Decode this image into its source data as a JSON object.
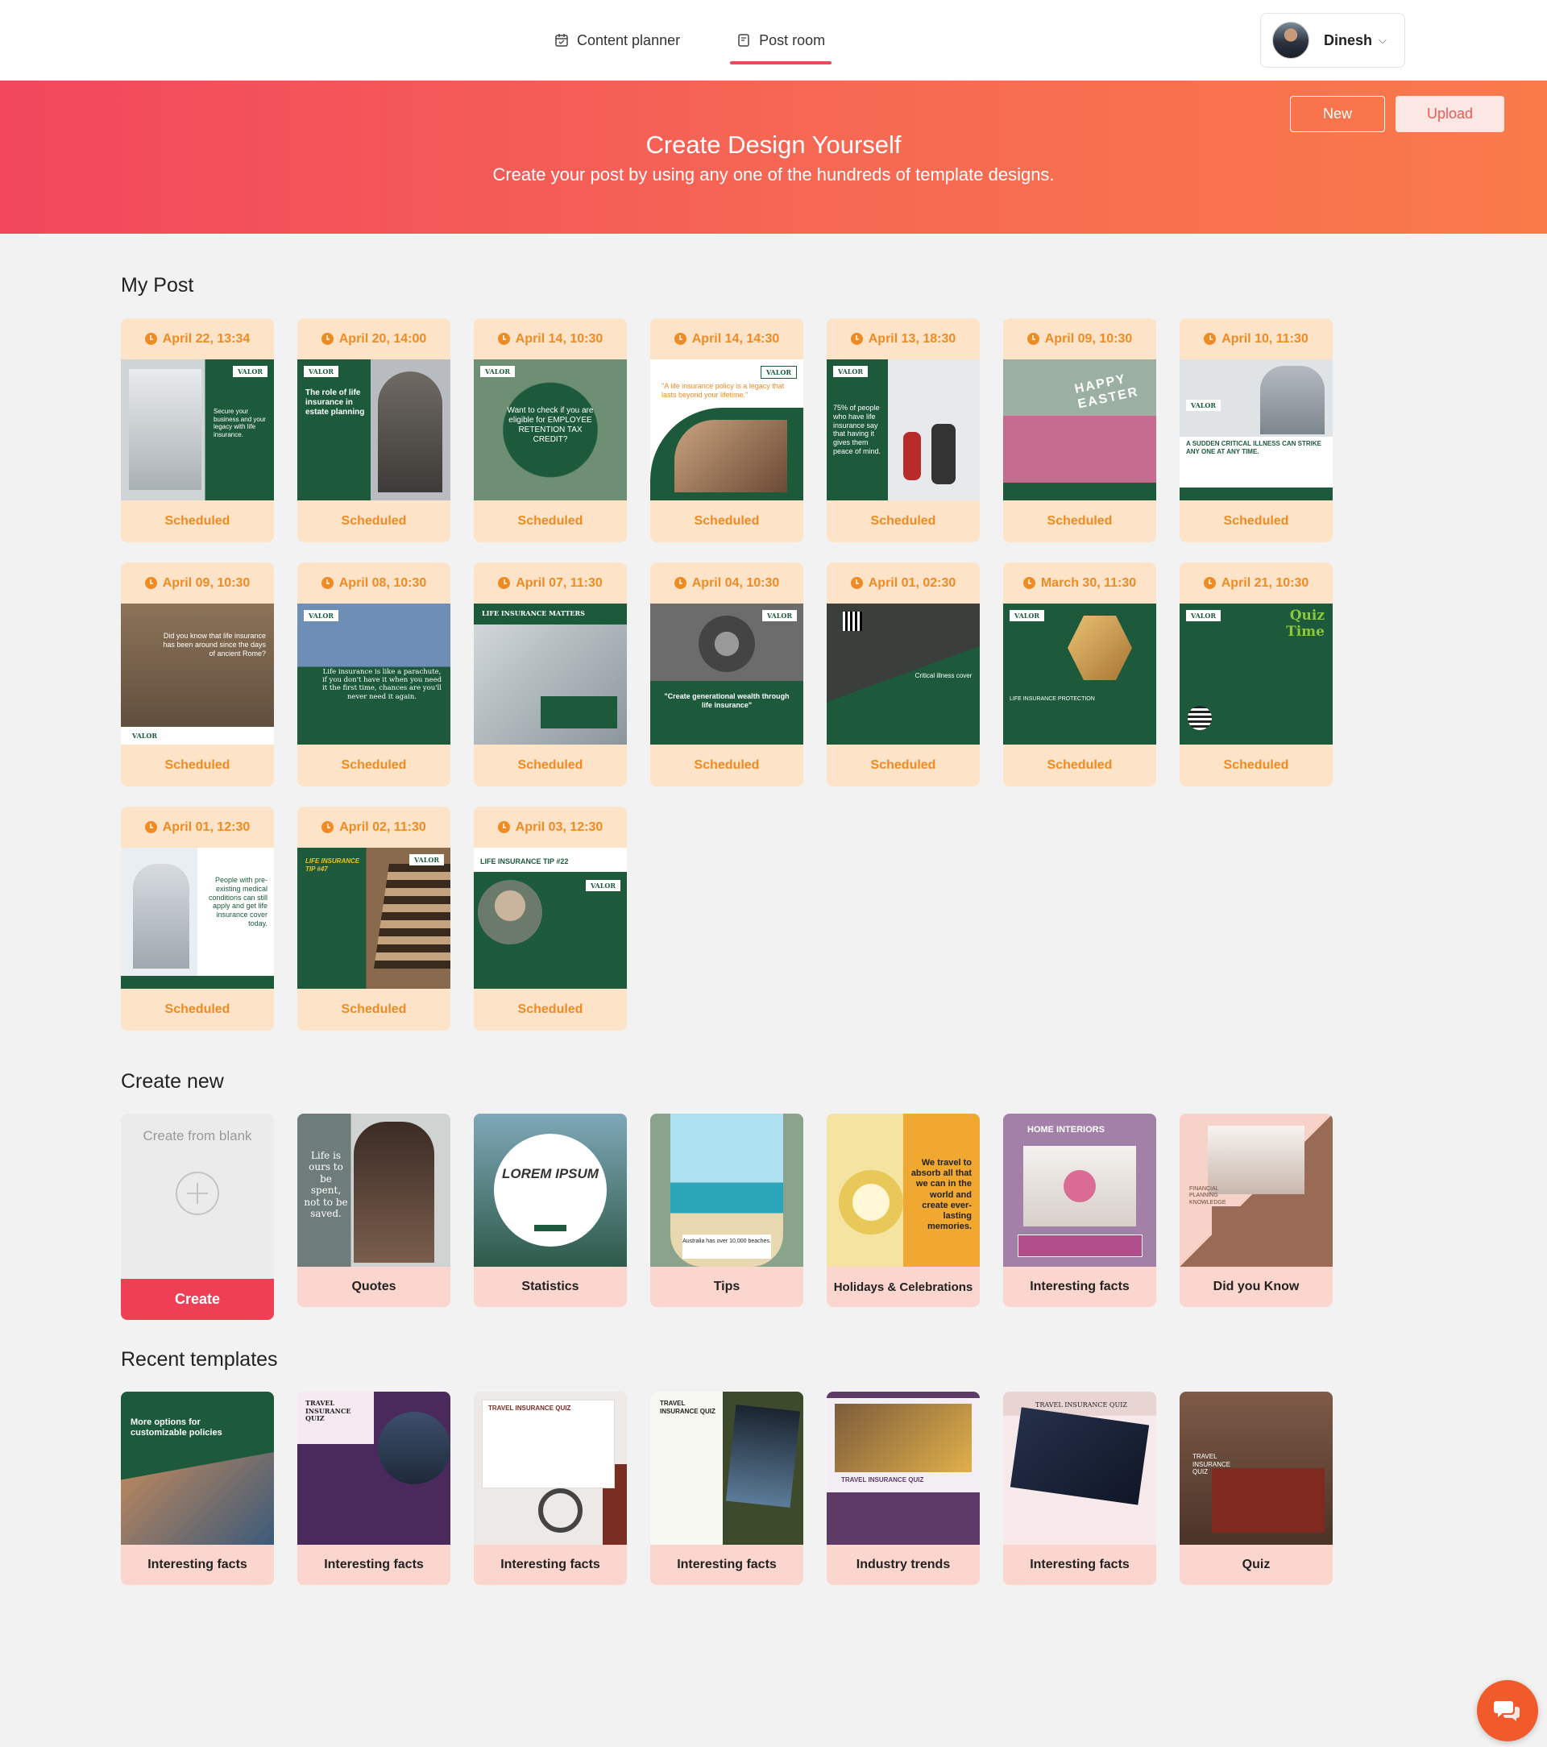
{
  "nav": {
    "content_planner": "Content planner",
    "post_room": "Post room"
  },
  "user": {
    "name": "Dinesh"
  },
  "banner": {
    "title": "Create Design Yourself",
    "subtitle": "Create your post by using any one of the hundreds of template designs.",
    "new_label": "New",
    "upload_label": "Upload"
  },
  "my_post": {
    "title": "My Post",
    "posts": [
      {
        "date": "April 22, 13:34",
        "status": "Scheduled",
        "headline": "Secure your business and your legacy with life insurance."
      },
      {
        "date": "April 20, 14:00",
        "status": "Scheduled",
        "headline": "The role of life insurance in estate planning"
      },
      {
        "date": "April 14, 10:30",
        "status": "Scheduled",
        "headline": "Want to check if you are eligible for EMPLOYEE RETENTION TAX CREDIT?"
      },
      {
        "date": "April 14, 14:30",
        "status": "Scheduled",
        "headline": "\"A life insurance policy is a legacy that lasts beyond your lifetime.\""
      },
      {
        "date": "April 13, 18:30",
        "status": "Scheduled",
        "headline": "75% of people who have life insurance say that having it gives them peace of mind."
      },
      {
        "date": "April 09, 10:30",
        "status": "Scheduled",
        "headline": "HAPPY EASTER"
      },
      {
        "date": "April 10, 11:30",
        "status": "Scheduled",
        "headline": "A SUDDEN CRITICAL ILLNESS CAN STRIKE ANY ONE AT ANY TIME."
      },
      {
        "date": "April 09, 10:30",
        "status": "Scheduled",
        "headline": "Did you know that life insurance has been around since the days of ancient Rome?"
      },
      {
        "date": "April 08, 10:30",
        "status": "Scheduled",
        "headline": "Life insurance is like a parachute, if you don't have it when you need it the first time, chances are you'll never need it again."
      },
      {
        "date": "April 07, 11:30",
        "status": "Scheduled",
        "headline": "LIFE INSURANCE MATTERS"
      },
      {
        "date": "April 04, 10:30",
        "status": "Scheduled",
        "headline": "\"Create generational wealth through life insurance\""
      },
      {
        "date": "April 01, 02:30",
        "status": "Scheduled",
        "headline": "Critical illness cover"
      },
      {
        "date": "March 30, 11:30",
        "status": "Scheduled",
        "headline": "LIFE INSURANCE PROTECTION"
      },
      {
        "date": "April 21, 10:30",
        "status": "Scheduled",
        "headline": "Quiz Time"
      },
      {
        "date": "April 01, 12:30",
        "status": "Scheduled",
        "headline": "People with pre-existing medical conditions can still apply and get life insurance cover today."
      },
      {
        "date": "April 02, 11:30",
        "status": "Scheduled",
        "headline": "LIFE INSURANCE TIP #47"
      },
      {
        "date": "April 03, 12:30",
        "status": "Scheduled",
        "headline": "LIFE INSURANCE TIP #22"
      }
    ]
  },
  "create_new": {
    "title": "Create new",
    "blank_label": "Create from blank",
    "create_label": "Create",
    "templates": [
      {
        "label": "Quotes",
        "thumb_text": "Life is ours to be spent, not to be saved."
      },
      {
        "label": "Statistics",
        "thumb_text": "LOREM IPSUM"
      },
      {
        "label": "Tips",
        "thumb_text": "Australia has over 10,000 beaches."
      },
      {
        "label": "Holidays & Celebrations",
        "thumb_text": "We travel to absorb all that we can in the world and create ever-lasting memories."
      },
      {
        "label": "Interesting facts",
        "thumb_text": "HOME INTERIORS"
      },
      {
        "label": "Did you Know",
        "thumb_text": "FINANCIAL PLANNING KNOWLEDGE"
      }
    ]
  },
  "recent": {
    "title": "Recent templates",
    "templates": [
      {
        "label": "Interesting facts",
        "thumb_text": "More options for customizable policies"
      },
      {
        "label": "Interesting facts",
        "thumb_text": "TRAVEL INSURANCE QUIZ"
      },
      {
        "label": "Interesting facts",
        "thumb_text": "TRAVEL INSURANCE QUIZ"
      },
      {
        "label": "Interesting facts",
        "thumb_text": "TRAVEL INSURANCE QUIZ"
      },
      {
        "label": "Industry trends",
        "thumb_text": "TRAVEL INSURANCE QUIZ"
      },
      {
        "label": "Interesting facts",
        "thumb_text": "TRAVEL INSURANCE QUIZ"
      },
      {
        "label": "Quiz",
        "thumb_text": "TRAVEL INSURANCE QUIZ"
      }
    ]
  },
  "colors": {
    "accent": "#ef4a5c",
    "banner_start": "#f2475d",
    "banner_end": "#fa7a4a",
    "scheduled": "#f08a23",
    "valor_green": "#1d5a3c"
  }
}
